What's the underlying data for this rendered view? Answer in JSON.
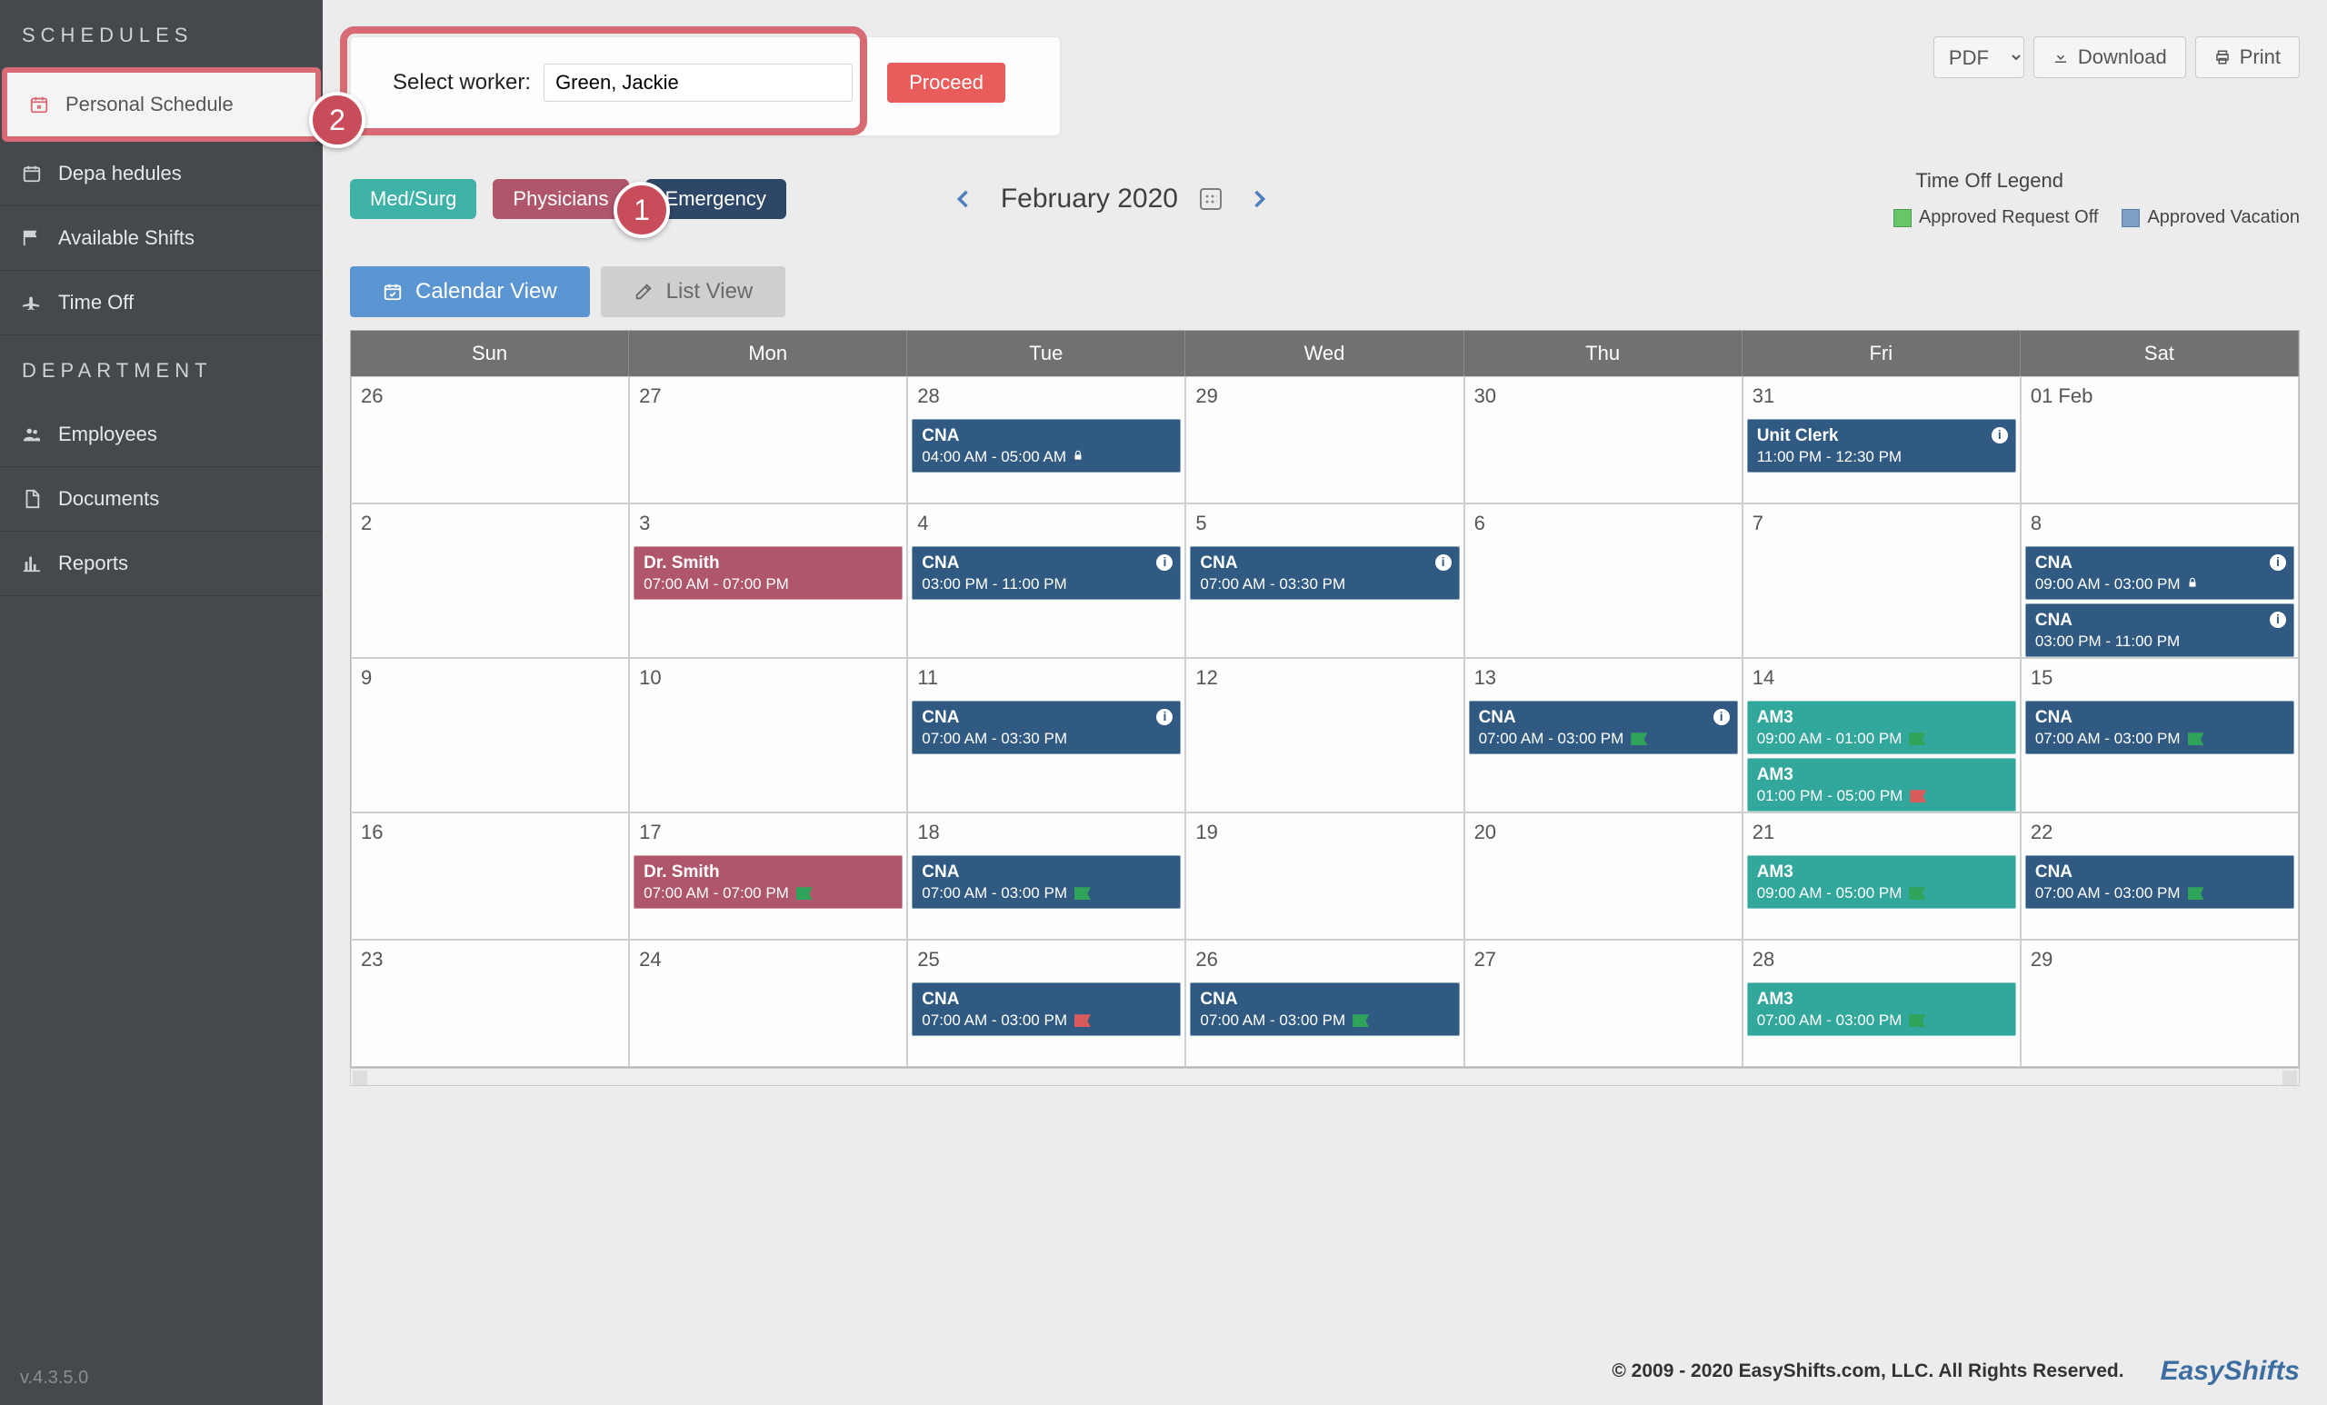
{
  "sidebar": {
    "section1": "SCHEDULES",
    "personal": "Personal Schedule",
    "dept_sched": "Depa                  hedules",
    "available": "Available Shifts",
    "timeoff": "Time Off",
    "section2": "DEPARTMENT",
    "employees": "Employees",
    "documents": "Documents",
    "reports": "Reports"
  },
  "worker_select": {
    "label": "Select worker:",
    "value": "Green, Jackie",
    "proceed": "Proceed"
  },
  "export_buttons": {
    "pdf": "PDF",
    "download": "Download",
    "print": "Print"
  },
  "dept_tabs": [
    "Med/Surg",
    "Physicians",
    "Emergency"
  ],
  "month_label": "February 2020",
  "legend": {
    "title": "Time Off Legend",
    "approved_off": "Approved Request Off",
    "approved_vac": "Approved Vacation"
  },
  "view_tabs": {
    "cal": "Calendar View",
    "list": "List View"
  },
  "day_headers": [
    "Sun",
    "Mon",
    "Tue",
    "Wed",
    "Thu",
    "Fri",
    "Sat"
  ],
  "weeks": [
    [
      {
        "num": "26",
        "events": []
      },
      {
        "num": "27",
        "events": []
      },
      {
        "num": "28",
        "events": [
          {
            "title": "CNA",
            "time": "04:00 AM - 05:00 AM",
            "color": "ev-blue",
            "lock": true
          }
        ]
      },
      {
        "num": "29",
        "events": []
      },
      {
        "num": "30",
        "events": []
      },
      {
        "num": "31",
        "events": [
          {
            "title": "Unit Clerk",
            "time": "11:00 PM - 12:30 PM",
            "color": "ev-blue",
            "info": true
          }
        ]
      },
      {
        "num": "01 Feb",
        "events": []
      }
    ],
    [
      {
        "num": "2",
        "events": []
      },
      {
        "num": "3",
        "events": [
          {
            "title": "Dr. Smith",
            "time": "07:00 AM - 07:00 PM",
            "color": "ev-pink"
          }
        ]
      },
      {
        "num": "4",
        "events": [
          {
            "title": "CNA",
            "time": "03:00 PM - 11:00 PM",
            "color": "ev-blue",
            "info": true
          }
        ]
      },
      {
        "num": "5",
        "events": [
          {
            "title": "CNA",
            "time": "07:00 AM - 03:30 PM",
            "color": "ev-blue",
            "info": true
          }
        ]
      },
      {
        "num": "6",
        "events": []
      },
      {
        "num": "7",
        "events": []
      },
      {
        "num": "8",
        "events": [
          {
            "title": "CNA",
            "time": "09:00 AM - 03:00 PM",
            "color": "ev-blue",
            "info": true,
            "lock": true
          },
          {
            "title": "CNA",
            "time": "03:00 PM - 11:00 PM",
            "color": "ev-blue",
            "info": true
          }
        ]
      }
    ],
    [
      {
        "num": "9",
        "events": []
      },
      {
        "num": "10",
        "events": []
      },
      {
        "num": "11",
        "events": [
          {
            "title": "CNA",
            "time": "07:00 AM - 03:30 PM",
            "color": "ev-blue",
            "info": true
          }
        ]
      },
      {
        "num": "12",
        "events": []
      },
      {
        "num": "13",
        "events": [
          {
            "title": "CNA",
            "time": "07:00 AM - 03:00 PM",
            "color": "ev-blue",
            "info": true,
            "flag": "green"
          }
        ]
      },
      {
        "num": "14",
        "events": [
          {
            "title": "AM3",
            "time": "09:00 AM - 01:00 PM",
            "color": "ev-teal",
            "flag": "green"
          },
          {
            "title": "AM3",
            "time": "01:00 PM - 05:00 PM",
            "color": "ev-teal",
            "flag": "red"
          }
        ]
      },
      {
        "num": "15",
        "events": [
          {
            "title": "CNA",
            "time": "07:00 AM - 03:00 PM",
            "color": "ev-blue",
            "flag": "green"
          }
        ]
      }
    ],
    [
      {
        "num": "16",
        "events": []
      },
      {
        "num": "17",
        "events": [
          {
            "title": "Dr. Smith",
            "time": "07:00 AM - 07:00 PM",
            "color": "ev-pink",
            "flag": "green"
          }
        ]
      },
      {
        "num": "18",
        "events": [
          {
            "title": "CNA",
            "time": "07:00 AM - 03:00 PM",
            "color": "ev-blue",
            "flag": "green"
          }
        ]
      },
      {
        "num": "19",
        "events": []
      },
      {
        "num": "20",
        "events": []
      },
      {
        "num": "21",
        "events": [
          {
            "title": "AM3",
            "time": "09:00 AM - 05:00 PM",
            "color": "ev-teal",
            "flag": "green"
          }
        ]
      },
      {
        "num": "22",
        "events": [
          {
            "title": "CNA",
            "time": "07:00 AM - 03:00 PM",
            "color": "ev-blue",
            "flag": "green"
          }
        ]
      }
    ],
    [
      {
        "num": "23",
        "events": []
      },
      {
        "num": "24",
        "events": []
      },
      {
        "num": "25",
        "events": [
          {
            "title": "CNA",
            "time": "07:00 AM - 03:00 PM",
            "color": "ev-blue",
            "flag": "red"
          }
        ]
      },
      {
        "num": "26",
        "events": [
          {
            "title": "CNA",
            "time": "07:00 AM - 03:00 PM",
            "color": "ev-blue",
            "flag": "green"
          }
        ]
      },
      {
        "num": "27",
        "events": []
      },
      {
        "num": "28",
        "events": [
          {
            "title": "AM3",
            "time": "07:00 AM - 03:00 PM",
            "color": "ev-teal",
            "flag": "green"
          }
        ]
      },
      {
        "num": "29",
        "events": []
      }
    ]
  ],
  "footer": "© 2009 - 2020 EasyShifts.com, LLC. All Rights Reserved.",
  "brand": "EasyShifts",
  "version": "v.4.3.5.0",
  "badges": {
    "b1": "1",
    "b2": "2"
  }
}
